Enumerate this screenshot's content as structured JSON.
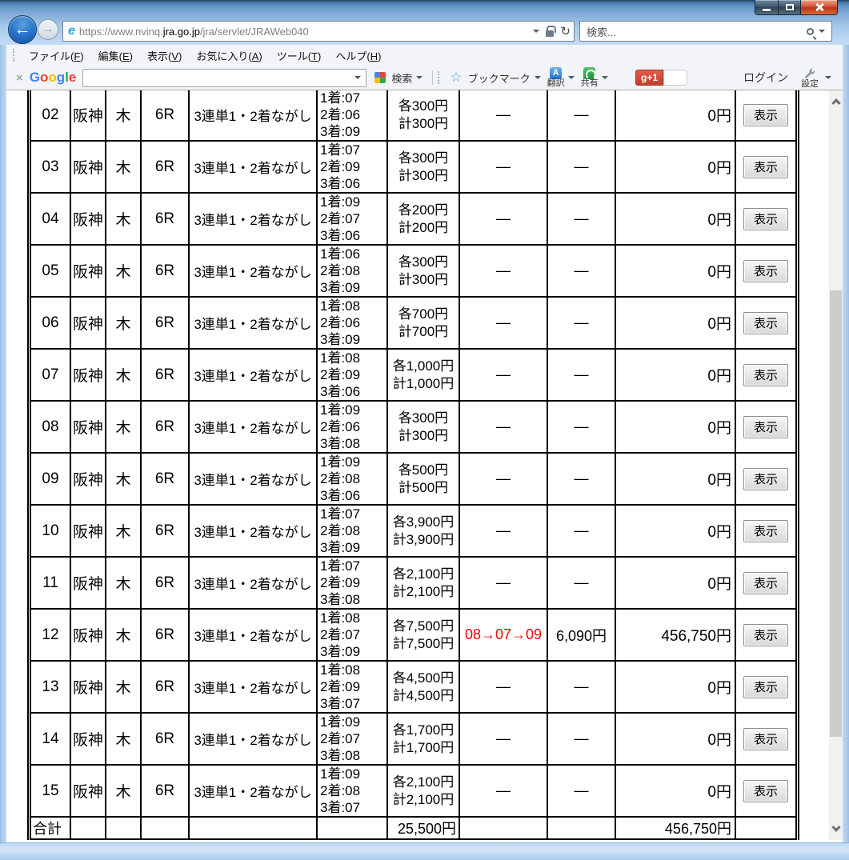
{
  "browser": {
    "url": {
      "prefix": "https://www.nvinq.",
      "domain": "jra.go.jp",
      "path": "/jra/servlet/JRAWeb040"
    },
    "search_placeholder": "検索...",
    "menu": [
      {
        "pre": "ファイル(",
        "key": "F",
        "post": ")"
      },
      {
        "pre": "編集(",
        "key": "E",
        "post": ")"
      },
      {
        "pre": "表示(",
        "key": "V",
        "post": ")"
      },
      {
        "pre": "お気に入り(",
        "key": "A",
        "post": ")"
      },
      {
        "pre": "ツール(",
        "key": "T",
        "post": ")"
      },
      {
        "pre": "ヘルプ(",
        "key": "H",
        "post": ")"
      }
    ],
    "gtoolbar": {
      "logo_letters": [
        {
          "ch": "G",
          "color": "#4285F4"
        },
        {
          "ch": "o",
          "color": "#EA4335"
        },
        {
          "ch": "o",
          "color": "#FBBC05"
        },
        {
          "ch": "g",
          "color": "#4285F4"
        },
        {
          "ch": "l",
          "color": "#34A853"
        },
        {
          "ch": "e",
          "color": "#EA4335"
        }
      ],
      "search_label": "検索",
      "bookmarks_label": "ブックマーク",
      "translate_label": "翻訳",
      "translate_icon_letter": "A",
      "share_label": "共有",
      "plusone_label": "g+1",
      "login_label": "ログイン",
      "settings_label": "設定"
    }
  },
  "table": {
    "rows": [
      {
        "no": "02",
        "venue": "阪神",
        "day": "木",
        "race": "6R",
        "bet_type": "3連単1・2着ながし",
        "places": [
          "1着:07",
          "2着:06",
          "3着:09"
        ],
        "amounts": [
          "各300円",
          "計300円"
        ],
        "result": "—",
        "payout": "—",
        "refund": "0円",
        "action": "表示",
        "highlight": false
      },
      {
        "no": "03",
        "venue": "阪神",
        "day": "木",
        "race": "6R",
        "bet_type": "3連単1・2着ながし",
        "places": [
          "1着:07",
          "2着:09",
          "3着:06"
        ],
        "amounts": [
          "各300円",
          "計300円"
        ],
        "result": "—",
        "payout": "—",
        "refund": "0円",
        "action": "表示",
        "highlight": false
      },
      {
        "no": "04",
        "venue": "阪神",
        "day": "木",
        "race": "6R",
        "bet_type": "3連単1・2着ながし",
        "places": [
          "1着:09",
          "2着:07",
          "3着:06"
        ],
        "amounts": [
          "各200円",
          "計200円"
        ],
        "result": "—",
        "payout": "—",
        "refund": "0円",
        "action": "表示",
        "highlight": false
      },
      {
        "no": "05",
        "venue": "阪神",
        "day": "木",
        "race": "6R",
        "bet_type": "3連単1・2着ながし",
        "places": [
          "1着:06",
          "2着:08",
          "3着:09"
        ],
        "amounts": [
          "各300円",
          "計300円"
        ],
        "result": "—",
        "payout": "—",
        "refund": "0円",
        "action": "表示",
        "highlight": false
      },
      {
        "no": "06",
        "venue": "阪神",
        "day": "木",
        "race": "6R",
        "bet_type": "3連単1・2着ながし",
        "places": [
          "1着:08",
          "2着:06",
          "3着:09"
        ],
        "amounts": [
          "各700円",
          "計700円"
        ],
        "result": "—",
        "payout": "—",
        "refund": "0円",
        "action": "表示",
        "highlight": false
      },
      {
        "no": "07",
        "venue": "阪神",
        "day": "木",
        "race": "6R",
        "bet_type": "3連単1・2着ながし",
        "places": [
          "1着:08",
          "2着:09",
          "3着:06"
        ],
        "amounts": [
          "各1,000円",
          "計1,000円"
        ],
        "result": "—",
        "payout": "—",
        "refund": "0円",
        "action": "表示",
        "highlight": false
      },
      {
        "no": "08",
        "venue": "阪神",
        "day": "木",
        "race": "6R",
        "bet_type": "3連単1・2着ながし",
        "places": [
          "1着:09",
          "2着:06",
          "3着:08"
        ],
        "amounts": [
          "各300円",
          "計300円"
        ],
        "result": "—",
        "payout": "—",
        "refund": "0円",
        "action": "表示",
        "highlight": false
      },
      {
        "no": "09",
        "venue": "阪神",
        "day": "木",
        "race": "6R",
        "bet_type": "3連単1・2着ながし",
        "places": [
          "1着:09",
          "2着:08",
          "3着:06"
        ],
        "amounts": [
          "各500円",
          "計500円"
        ],
        "result": "—",
        "payout": "—",
        "refund": "0円",
        "action": "表示",
        "highlight": false
      },
      {
        "no": "10",
        "venue": "阪神",
        "day": "木",
        "race": "6R",
        "bet_type": "3連単1・2着ながし",
        "places": [
          "1着:07",
          "2着:08",
          "3着:09"
        ],
        "amounts": [
          "各3,900円",
          "計3,900円"
        ],
        "result": "—",
        "payout": "—",
        "refund": "0円",
        "action": "表示",
        "highlight": false
      },
      {
        "no": "11",
        "venue": "阪神",
        "day": "木",
        "race": "6R",
        "bet_type": "3連単1・2着ながし",
        "places": [
          "1着:07",
          "2着:09",
          "3着:08"
        ],
        "amounts": [
          "各2,100円",
          "計2,100円"
        ],
        "result": "—",
        "payout": "—",
        "refund": "0円",
        "action": "表示",
        "highlight": false
      },
      {
        "no": "12",
        "venue": "阪神",
        "day": "木",
        "race": "6R",
        "bet_type": "3連単1・2着ながし",
        "places": [
          "1着:08",
          "2着:07",
          "3着:09"
        ],
        "amounts": [
          "各7,500円",
          "計7,500円"
        ],
        "result": "08→07→09",
        "payout": "6,090円",
        "refund": "456,750円",
        "action": "表示",
        "highlight": true
      },
      {
        "no": "13",
        "venue": "阪神",
        "day": "木",
        "race": "6R",
        "bet_type": "3連単1・2着ながし",
        "places": [
          "1着:08",
          "2着:09",
          "3着:07"
        ],
        "amounts": [
          "各4,500円",
          "計4,500円"
        ],
        "result": "—",
        "payout": "—",
        "refund": "0円",
        "action": "表示",
        "highlight": false
      },
      {
        "no": "14",
        "venue": "阪神",
        "day": "木",
        "race": "6R",
        "bet_type": "3連単1・2着ながし",
        "places": [
          "1着:09",
          "2着:07",
          "3着:08"
        ],
        "amounts": [
          "各1,700円",
          "計1,700円"
        ],
        "result": "—",
        "payout": "—",
        "refund": "0円",
        "action": "表示",
        "highlight": false
      },
      {
        "no": "15",
        "venue": "阪神",
        "day": "木",
        "race": "6R",
        "bet_type": "3連単1・2着ながし",
        "places": [
          "1着:09",
          "2着:08",
          "3着:07"
        ],
        "amounts": [
          "各2,100円",
          "計2,100円"
        ],
        "result": "—",
        "payout": "—",
        "refund": "0円",
        "action": "表示",
        "highlight": false
      }
    ],
    "totals": {
      "label": "合計",
      "amount": "25,500円",
      "refund": "456,750円"
    }
  },
  "colors": {
    "result_highlight": "#ff0000"
  }
}
